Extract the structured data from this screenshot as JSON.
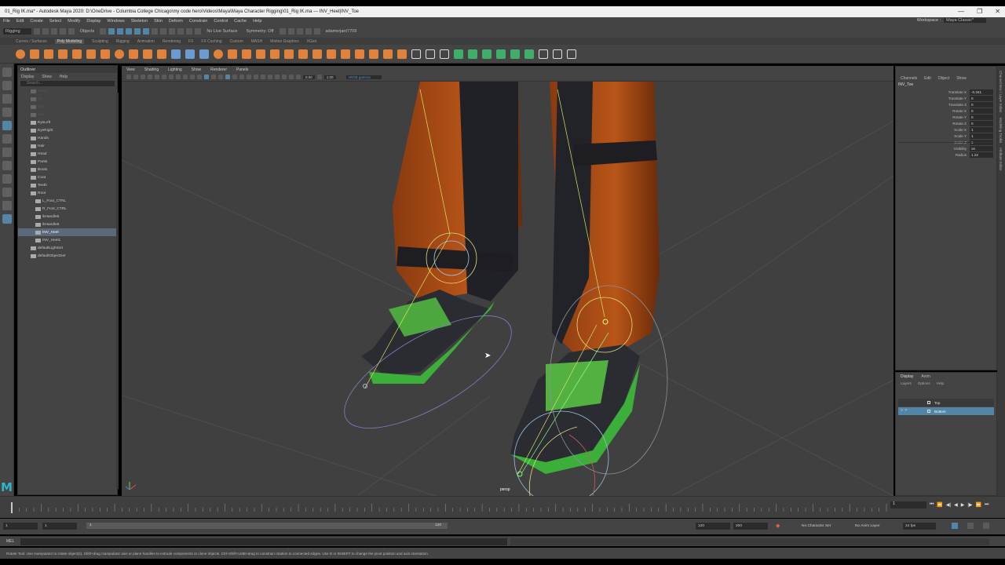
{
  "window": {
    "title": "01_Rig IK.ma* - Autodesk Maya 2020: D:\\OneDrive - Columbia College Chicago\\my code hero\\Videos\\Maya\\Maya Character Rigging\\01_Rig IK.ma  ---  INV_Heel|INV_Toe",
    "minimize": "—",
    "maximize": "❐",
    "close": "✕"
  },
  "menu": {
    "items": [
      "File",
      "Edit",
      "Create",
      "Select",
      "Modify",
      "Display",
      "Windows",
      "Skeleton",
      "Skin",
      "Deform",
      "Constrain",
      "Control",
      "Cache",
      "Help"
    ],
    "workspace_label": "Workspace :",
    "workspace_value": "Maya Classic*"
  },
  "status_line": {
    "menu_set": "Rigging",
    "objects_label": "Objects",
    "live_surface": "No Live Surface",
    "symmetry": "Symmetry: Off",
    "account": "adamerjant7709"
  },
  "shelf": {
    "tabs": [
      "Curves / Surfaces",
      "Poly Modeling",
      "Sculpting",
      "Rigging",
      "Animation",
      "Rendering",
      "FX",
      "FX Caching",
      "Custom",
      "MASH",
      "Motion Graphics",
      "XGen"
    ],
    "active_tab": "Poly Modeling"
  },
  "outliner": {
    "title": "Outliner",
    "menu": [
      "Display",
      "Show",
      "Help"
    ],
    "search_placeholder": "Search...",
    "items": [
      {
        "label": "persp",
        "grey": true,
        "child": false
      },
      {
        "label": "top",
        "grey": true,
        "child": false
      },
      {
        "label": "front",
        "grey": true,
        "child": false
      },
      {
        "label": "side",
        "grey": true,
        "child": false
      },
      {
        "label": "EyeLeft",
        "grey": false,
        "child": false
      },
      {
        "label": "EyeRight",
        "grey": false,
        "child": false
      },
      {
        "label": "Hands",
        "grey": false,
        "child": false
      },
      {
        "label": "Hair",
        "grey": false,
        "child": false
      },
      {
        "label": "Head",
        "grey": false,
        "child": false
      },
      {
        "label": "Pants",
        "grey": false,
        "child": false
      },
      {
        "label": "Boots",
        "grey": false,
        "child": false
      },
      {
        "label": "Coat",
        "grey": false,
        "child": false
      },
      {
        "label": "Teeth",
        "grey": false,
        "child": false
      },
      {
        "label": "Root",
        "grey": false,
        "child": false
      },
      {
        "label": "L_Foot_CTRL",
        "grey": false,
        "child": true
      },
      {
        "label": "R_Foot_CTRL",
        "grey": false,
        "child": true
      },
      {
        "label": "ikHandle5",
        "grey": false,
        "child": true
      },
      {
        "label": "ikHandle6",
        "grey": false,
        "child": true
      },
      {
        "label": "INV_Heel",
        "grey": false,
        "child": true,
        "selected": true
      },
      {
        "label": "INV_Heel1",
        "grey": false,
        "child": true
      },
      {
        "label": "defaultLightSet",
        "grey": false,
        "child": false
      },
      {
        "label": "defaultObjectSet",
        "grey": false,
        "child": false
      }
    ]
  },
  "viewport": {
    "menu": [
      "View",
      "Shading",
      "Lighting",
      "Show",
      "Renderer",
      "Panels"
    ],
    "exposure": "0.00",
    "gamma": "1.00",
    "color_space": "sRGB gamma",
    "camera_label": "persp"
  },
  "channel_box": {
    "menu": [
      "Channels",
      "Edit",
      "Object",
      "Show"
    ],
    "object_name": "INV_Toe",
    "attributes": [
      {
        "name": "Translate X",
        "value": "-0.341"
      },
      {
        "name": "Translate Y",
        "value": "0"
      },
      {
        "name": "Translate Z",
        "value": "0"
      },
      {
        "name": "Rotate X",
        "value": "0"
      },
      {
        "name": "Rotate Y",
        "value": "0"
      },
      {
        "name": "Rotate Z",
        "value": "0"
      },
      {
        "name": "Scale X",
        "value": "1"
      },
      {
        "name": "Scale Y",
        "value": "1"
      },
      {
        "name": "Scale Z",
        "value": "1"
      },
      {
        "name": "Visibility",
        "value": "on"
      },
      {
        "name": "Radius",
        "value": "1.22"
      }
    ],
    "side_tabs": [
      "Channel Box / Layer Editor",
      "Modeling Toolkit",
      "Attribute Editor"
    ]
  },
  "layer_editor": {
    "tabs": [
      "Display",
      "Anim"
    ],
    "active_tab": "Display",
    "menu": [
      "Layers",
      "Options",
      "Help"
    ],
    "layers": [
      {
        "label": "Top",
        "v": "",
        "p": "",
        "selected": false
      },
      {
        "label": "Bottom",
        "v": "V",
        "p": "P",
        "selected": true
      }
    ]
  },
  "time_slider": {
    "tick_labels": [
      "1",
      "5",
      "10",
      "15",
      "20",
      "25",
      "30",
      "35",
      "40",
      "45",
      "50",
      "55",
      "60",
      "65",
      "70",
      "75",
      "80",
      "85",
      "90",
      "95",
      "100",
      "105",
      "110",
      "115",
      "120"
    ],
    "current_frame": "1"
  },
  "range_slider": {
    "start": "1",
    "playback_start": "1",
    "range_start_label": "1",
    "range_end_label": "120",
    "playback_end": "120",
    "end": "200",
    "fps": "24 fps",
    "character_set": "No Character Set",
    "anim_layer": "No Anim Layer"
  },
  "command_line": {
    "language": "MEL"
  },
  "help_line": {
    "text": "Rotate Tool: Use manipulator to rotate object(s). Shift+drag manipulator axis or plane handles to extrude components or clone objects. Ctrl+Shift+LMB+drag to constrain rotation to connected edges. Use D or INSERT to change the pivot position and axis orientation."
  }
}
